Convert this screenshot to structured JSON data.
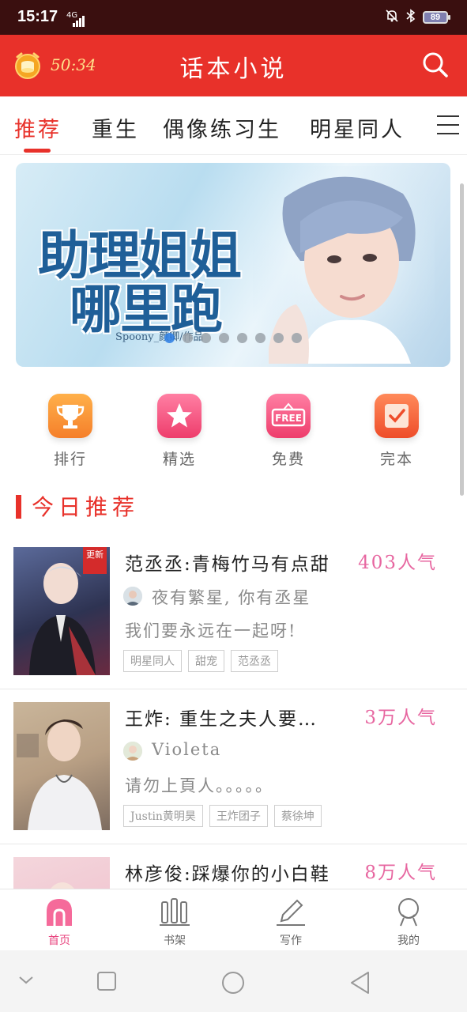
{
  "status_bar": {
    "time": "15:17",
    "network": "4G",
    "battery": "89"
  },
  "header": {
    "timer": "50:34",
    "title": "话本小说"
  },
  "tabs": [
    {
      "label": "推荐",
      "active": true
    },
    {
      "label": "重生",
      "active": false
    },
    {
      "label": "偶像练习生",
      "active": false
    },
    {
      "label": "明星同人",
      "active": false
    }
  ],
  "banner": {
    "title_line1": "助理姐姐",
    "title_line2": "哪里跑",
    "credit": "Spoony_颜卿/作品",
    "slide_count": 8,
    "active_slide": 0
  },
  "quick_entries": [
    {
      "label": "排行",
      "icon": "trophy-icon",
      "color": "#f6923a"
    },
    {
      "label": "精选",
      "icon": "star-icon",
      "color": "#f2517e"
    },
    {
      "label": "免费",
      "icon": "free-tag-icon",
      "color": "#f2517e"
    },
    {
      "label": "完本",
      "icon": "check-icon",
      "color": "#f36a3a"
    }
  ],
  "section": {
    "title": "今日推荐"
  },
  "books": [
    {
      "title": "范丞丞:青梅竹马有点甜",
      "popularity": "403人气",
      "author": "夜有繁星, 你有丞星",
      "description": "我们要永远在一起呀!",
      "tags": [
        "明星同人",
        "甜宠",
        "范丞丞"
      ],
      "badge": "更新"
    },
    {
      "title": "王炸:  重生之夫人要…",
      "popularity": "3万人气",
      "author": "Violeta",
      "description": "请勿上頁人。。。。。",
      "tags": [
        "Justin黄明昊",
        "王炸团子",
        "蔡徐坤"
      ],
      "badge": ""
    },
    {
      "title": "林彦俊:踩爆你的小白鞋",
      "popularity": "8万人气",
      "author": "",
      "description": "",
      "tags": [],
      "badge": ""
    }
  ],
  "bottom_nav": [
    {
      "label": "首页",
      "icon": "home-arch-icon",
      "active": true
    },
    {
      "label": "书架",
      "icon": "bookshelf-icon",
      "active": false
    },
    {
      "label": "写作",
      "icon": "pencil-icon",
      "active": false
    },
    {
      "label": "我的",
      "icon": "profile-icon",
      "active": false
    }
  ],
  "colors": {
    "brand": "#e8312a",
    "popularity": "#e766a0",
    "active_nav": "#e8457f"
  }
}
